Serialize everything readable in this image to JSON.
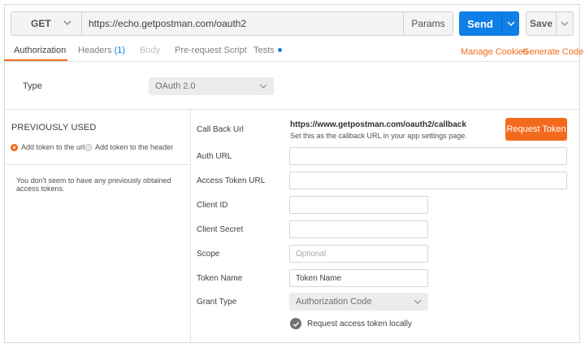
{
  "request": {
    "method": "GET",
    "url": "https://echo.getpostman.com/oauth2",
    "params_label": "Params",
    "send_label": "Send",
    "save_label": "Save"
  },
  "tabs": [
    {
      "label": "Authorization"
    },
    {
      "label": "Headers",
      "count": "(1)"
    },
    {
      "label": "Body"
    },
    {
      "label": "Pre-request Script"
    },
    {
      "label": "Tests"
    }
  ],
  "links": {
    "manage_cookies": "Manage Cookies",
    "generate_code": "Generate Code"
  },
  "auth": {
    "type_label": "Type",
    "type_value": "OAuth 2.0"
  },
  "previous": {
    "title": "PREVIOUSLY USED",
    "radio_url": "Add token to the url",
    "radio_header": "Add token to the header",
    "selected": "url",
    "empty_message": "You don't seem to have any previously obtained access tokens."
  },
  "form": {
    "callback_label": "Call Back Url",
    "callback_url": "https://www.getpostman.com/oauth2/callback",
    "callback_hint": "Set this as the callback URL in your app settings page.",
    "request_token_label": "Request Token",
    "auth_url_label": "Auth URL",
    "auth_url_value": "",
    "access_token_url_label": "Access Token URL",
    "access_token_url_value": "",
    "client_id_label": "Client ID",
    "client_id_value": "",
    "client_secret_label": "Client Secret",
    "client_secret_value": "",
    "scope_label": "Scope",
    "scope_placeholder": "Optional",
    "token_name_label": "Token Name",
    "token_name_value": "Token Name",
    "grant_type_label": "Grant Type",
    "grant_type_value": "Authorization Code",
    "request_locally_label": "Request access token locally",
    "request_locally_checked": true
  },
  "colors": {
    "accent": "#f26b1d",
    "primary": "#0f7fe6"
  }
}
